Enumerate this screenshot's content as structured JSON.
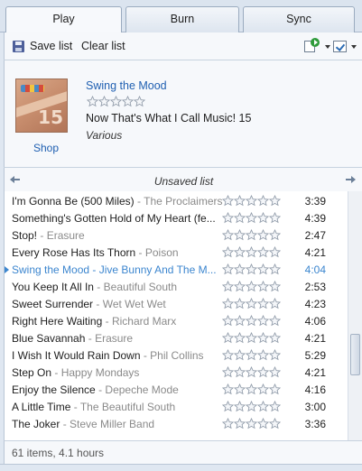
{
  "tabs": [
    {
      "label": "Play",
      "active": true
    },
    {
      "label": "Burn",
      "active": false
    },
    {
      "label": "Sync",
      "active": false
    }
  ],
  "toolbar": {
    "save_label": "Save list",
    "clear_label": "Clear list",
    "icons": [
      "save-icon",
      "playlist-options-icon",
      "list-options-icon"
    ]
  },
  "now_playing": {
    "title": "Swing the Mood",
    "rating": 0,
    "album": "Now That's What I Call Music! 15",
    "artist": "Various",
    "shop_label": "Shop"
  },
  "list": {
    "title": "Unsaved list",
    "items": [
      {
        "title": "I'm Gonna Be (500 Miles)",
        "artist": "The Proclaimers",
        "length": "3:39",
        "playing": false
      },
      {
        "title": "Something's Gotten Hold of My Heart (fe...",
        "artist": "",
        "length": "4:39",
        "playing": false
      },
      {
        "title": "Stop!",
        "artist": "Erasure",
        "length": "2:47",
        "playing": false
      },
      {
        "title": "Every Rose Has Its Thorn",
        "artist": "Poison",
        "length": "4:21",
        "playing": false
      },
      {
        "title": "Swing the Mood",
        "artist": "Jive Bunny And The M...",
        "length": "4:04",
        "playing": true
      },
      {
        "title": "You Keep It All In",
        "artist": "Beautiful South",
        "length": "2:53",
        "playing": false
      },
      {
        "title": "Sweet Surrender",
        "artist": "Wet Wet Wet",
        "length": "4:23",
        "playing": false
      },
      {
        "title": "Right Here Waiting",
        "artist": "Richard Marx",
        "length": "4:06",
        "playing": false
      },
      {
        "title": "Blue Savannah",
        "artist": "Erasure",
        "length": "4:21",
        "playing": false
      },
      {
        "title": "I Wish It Would Rain Down",
        "artist": "Phil Collins",
        "length": "5:29",
        "playing": false
      },
      {
        "title": "Step On",
        "artist": "Happy Mondays",
        "length": "4:21",
        "playing": false
      },
      {
        "title": "Enjoy the Silence",
        "artist": "Depeche Mode",
        "length": "4:16",
        "playing": false
      },
      {
        "title": "A Little Time",
        "artist": "The Beautiful South",
        "length": "3:00",
        "playing": false
      },
      {
        "title": "The Joker",
        "artist": "Steve Miller Band",
        "length": "3:36",
        "playing": false
      }
    ]
  },
  "status": {
    "text": "61 items, 4.1 hours"
  },
  "colors": {
    "link": "#1f5fb1",
    "playing": "#3c86cf",
    "artist_gray": "#8a8a8a"
  }
}
